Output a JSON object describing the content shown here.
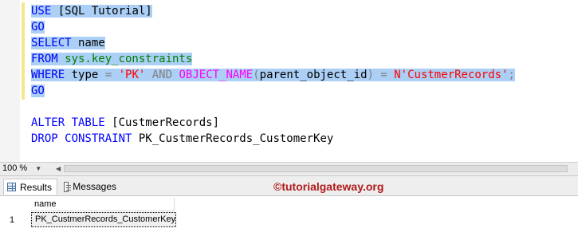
{
  "editor": {
    "lines": {
      "l1": {
        "use": "USE",
        "db": " [SQL Tutorial]"
      },
      "l2": {
        "go": "GO"
      },
      "l3": {
        "select": "SELECT",
        "name": " name"
      },
      "l4": {
        "from": "FROM",
        "obj": " sys.key_constraints"
      },
      "l5": {
        "where": "WHERE",
        "type": " type ",
        "eq1": "=",
        "pk": " 'PK' ",
        "and": "AND",
        "fn": " OBJECT_NAME",
        "lp": "(",
        "arg": "parent_object_id",
        "rp": ")",
        "eq2": " = ",
        "val": "N'CustmerRecords'",
        "semi": ";"
      },
      "l6": {
        "go": "GO"
      },
      "l8": {
        "alter": "ALTER TABLE",
        "tbl": " [CustmerRecords]"
      },
      "l9": {
        "drop": "DROP CONSTRAINT",
        "con": " PK_CustmerRecords_CustomerKey"
      }
    }
  },
  "zoom": {
    "value": "100 %"
  },
  "tabs": {
    "results": "Results",
    "messages": "Messages"
  },
  "watermark": "©tutorialgateway.org",
  "results": {
    "columns": [
      "name"
    ],
    "rows": [
      {
        "num": "1",
        "name": "PK_CustmerRecords_CustomerKey"
      }
    ]
  },
  "colors": {
    "keyword": "#0000ff",
    "system_object": "#008000",
    "string": "#ff0000",
    "function": "#ff00ff",
    "selection": "#abcff5",
    "watermark": "#b01b1b"
  },
  "icons": [
    "grid-icon",
    "messages-icon",
    "dropdown-arrow-icon",
    "scroll-left-icon"
  ]
}
